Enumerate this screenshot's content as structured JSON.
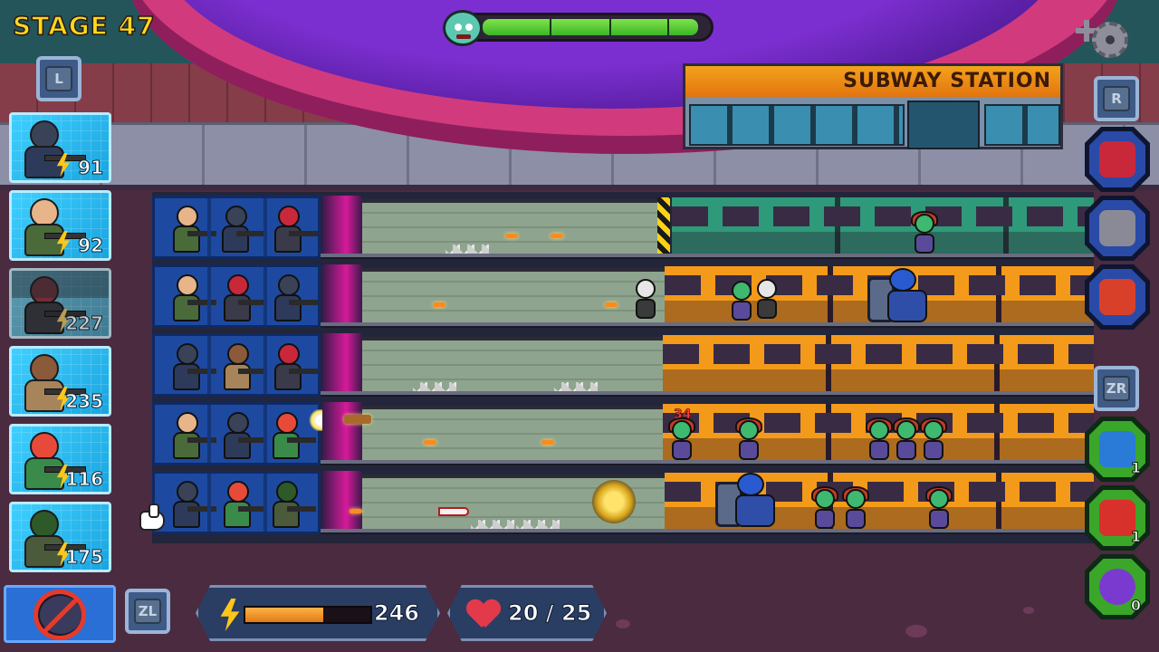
{
  "hud": {
    "stage_label": "STAGE 47",
    "boss_health_fraction": 0.95,
    "settings_icon": "gear-icon",
    "key_l": "L",
    "key_r": "R",
    "key_zl": "ZL",
    "key_zr": "ZR"
  },
  "scenery": {
    "station_sign": "SUBWAY STATION"
  },
  "unit_cards": [
    {
      "cost": "91",
      "unit": "riot-helmet-soldier",
      "available": true
    },
    {
      "cost": "92",
      "unit": "rifleman",
      "available": true
    },
    {
      "cost": "227",
      "unit": "red-helmet-sniper",
      "available": false
    },
    {
      "cost": "235",
      "unit": "heavy-gunner",
      "available": true
    },
    {
      "cost": "116",
      "unit": "bazooka-soldier",
      "available": true
    },
    {
      "cost": "175",
      "unit": "green-cap-gunner",
      "available": true
    }
  ],
  "items": [
    {
      "name": "dynamite-bundle-icon",
      "count": null
    },
    {
      "name": "spiked-bumper-icon",
      "count": null
    },
    {
      "name": "grenade-pack-icon",
      "count": null
    },
    {
      "name": "energy-cards-icon",
      "count": "1"
    },
    {
      "name": "medkit-icon",
      "count": "1"
    },
    {
      "name": "virus-orb-icon",
      "count": "0"
    }
  ],
  "energy": {
    "value": "246",
    "fill_fraction": 0.62
  },
  "health": {
    "label": "20 / 25"
  },
  "combat": {
    "damage_popup": "34"
  },
  "colors": {
    "stage_text": "#ffd820",
    "card_blue": "#1aa4e0",
    "lane_bunker": "#1d4aa0",
    "item_green": "#3aa62a",
    "item_blue": "#2a4aa8"
  }
}
